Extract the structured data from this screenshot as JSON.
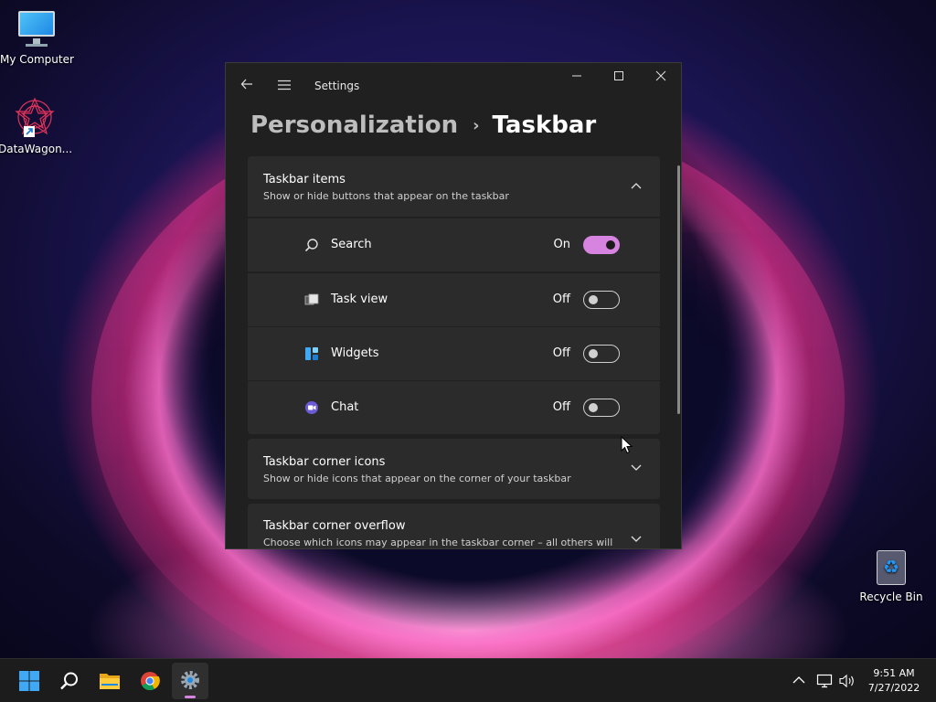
{
  "desktop": {
    "icons": [
      {
        "label": "My Computer"
      },
      {
        "label": "DataWagon..."
      },
      {
        "label": "Recycle Bin"
      }
    ]
  },
  "window": {
    "app_title": "Settings",
    "breadcrumb": {
      "parent": "Personalization",
      "separator": "›",
      "current": "Taskbar"
    },
    "taskbar_items": {
      "title": "Taskbar items",
      "subtitle": "Show or hide buttons that appear on the taskbar",
      "expanded": true,
      "rows": [
        {
          "label": "Search",
          "state": "On",
          "on": true,
          "icon": "search-icon"
        },
        {
          "label": "Task view",
          "state": "Off",
          "on": false,
          "icon": "task-view-icon"
        },
        {
          "label": "Widgets",
          "state": "Off",
          "on": false,
          "icon": "widgets-icon"
        },
        {
          "label": "Chat",
          "state": "Off",
          "on": false,
          "icon": "chat-icon"
        }
      ]
    },
    "corner_icons": {
      "title": "Taskbar corner icons",
      "subtitle": "Show or hide icons that appear on the corner of your taskbar"
    },
    "corner_overflow": {
      "title": "Taskbar corner overflow",
      "subtitle": "Choose which icons may appear in the taskbar corner – all others will"
    },
    "accent_color": "#d783e0"
  },
  "taskbar": {
    "apps": [
      "start-icon",
      "search-icon",
      "file-explorer-icon",
      "chrome-icon",
      "settings-icon"
    ],
    "clock": {
      "time": "9:51 AM",
      "date": "7/27/2022"
    }
  }
}
